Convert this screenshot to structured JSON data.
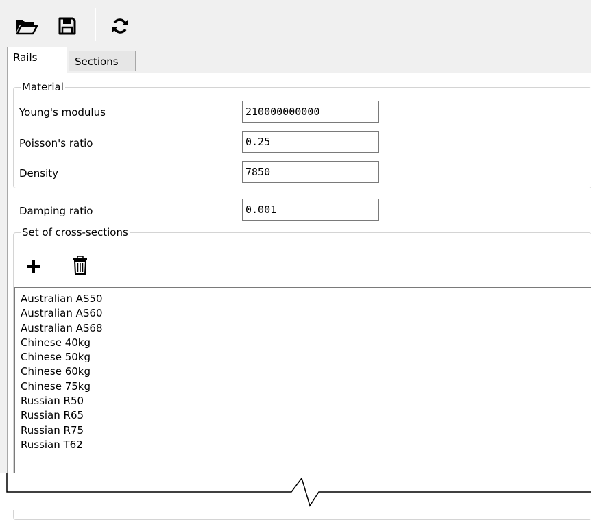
{
  "toolbar": {
    "buttons": [
      {
        "name": "open-folder-icon"
      },
      {
        "name": "save-icon"
      },
      {
        "name": "refresh-icon"
      }
    ]
  },
  "tabs": [
    {
      "label": "Rails",
      "active": true
    },
    {
      "label": "Sections",
      "active": false
    }
  ],
  "material": {
    "title": "Material",
    "rows": [
      {
        "label": "Young's modulus",
        "value": "210000000000"
      },
      {
        "label": "Poisson's ratio",
        "value": "0.25"
      },
      {
        "label": "Density",
        "value": "7850"
      }
    ]
  },
  "damping": {
    "label": "Damping ratio",
    "value": "0.001"
  },
  "cross_sections": {
    "title": "Set of cross-sections",
    "add_icon": "plus-icon",
    "delete_icon": "trash-icon",
    "items": [
      "Australian AS50",
      "Australian AS60",
      "Australian AS68",
      "Chinese 40kg",
      "Chinese 50kg",
      "Chinese 60kg",
      "Chinese 75kg",
      "Russian R50",
      "Russian R65",
      "Russian R75",
      "Russian T62"
    ]
  }
}
